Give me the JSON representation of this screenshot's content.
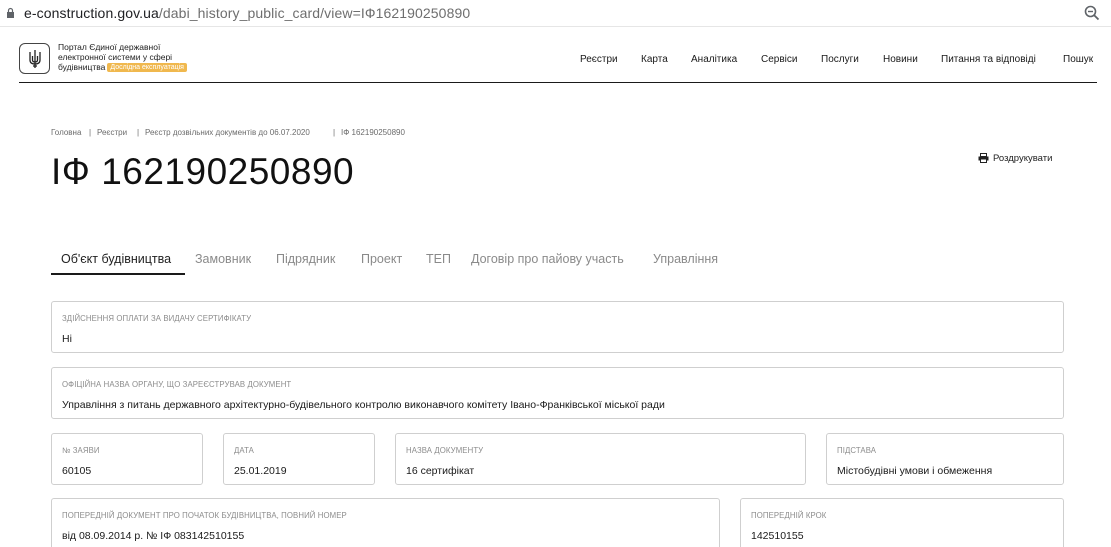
{
  "browser": {
    "url_domain": "e-construction.gov.ua",
    "url_path": "/dabi_history_public_card/view=ІФ162190250890"
  },
  "header": {
    "portal_name": "Портал Єдиної державної електронної системи у сфері будівництва",
    "beta_badge": "Дослідна експлуатація",
    "nav": [
      "Реєстри",
      "Карта",
      "Аналітика",
      "Сервіси",
      "Послуги",
      "Новини",
      "Питання та відповіді",
      "Пошук"
    ]
  },
  "breadcrumb": [
    "Головна",
    "Реєстри",
    "Реєстр дозвільних документів до 06.07.2020",
    "ІФ 162190250890"
  ],
  "page": {
    "title": "ІФ 162190250890",
    "print_label": "Роздрукувати"
  },
  "tabs": [
    "Об'єкт будівництва",
    "Замовник",
    "Підрядник",
    "Проект",
    "ТЕП",
    "Договір про пайову участь",
    "Управління"
  ],
  "fields": {
    "payment": {
      "label": "Здійснення оплати за видачу сертифікату",
      "value": "Ні"
    },
    "authority": {
      "label": "Офіційна назва органу, що зареєстрував документ",
      "value": "Управління з питань державного архітектурно-будівельного контролю виконавчого комітету Івано-Франківської міської ради"
    },
    "application_no": {
      "label": "№ заяви",
      "value": "60105"
    },
    "date": {
      "label": "Дата",
      "value": "25.01.2019"
    },
    "doc_name": {
      "label": "Назва документу",
      "value": "16 сертифікат"
    },
    "basis": {
      "label": "Підстава",
      "value": "Містобудівні умови і обмеження"
    },
    "prev_document": {
      "label": "Попередній документ про початок будівництва, повний номер",
      "value": "від 08.09.2014 р. № ІФ 083142510155"
    },
    "prev_step": {
      "label": "Попередній крок",
      "value": "142510155"
    }
  },
  "colors": {
    "accent_badge": "#f0b84e",
    "border": "#cfcfcf",
    "muted_text": "#8c8c8c"
  }
}
